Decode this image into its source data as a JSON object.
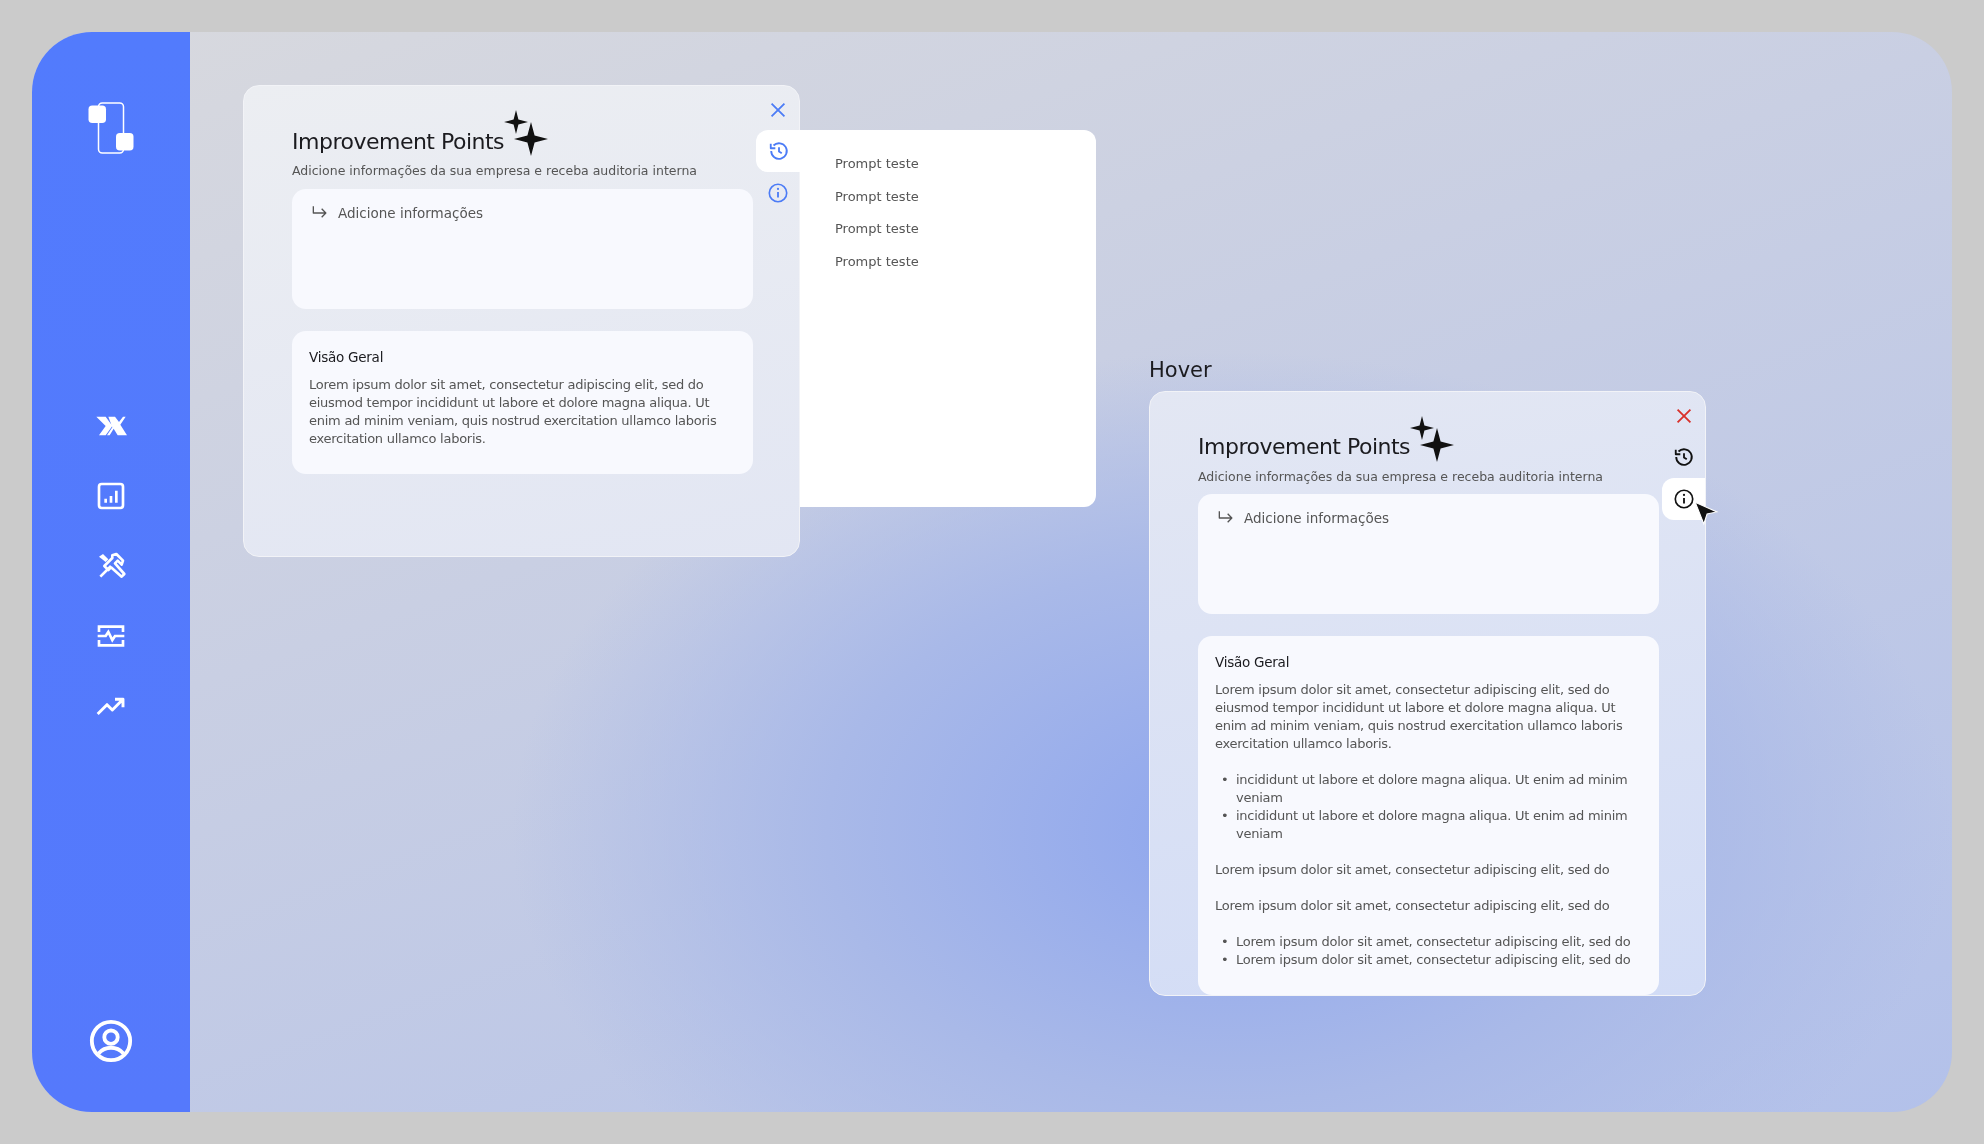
{
  "sidebar": {
    "items": [
      {
        "kind": "x-mark"
      },
      {
        "kind": "chart"
      },
      {
        "kind": "tools"
      },
      {
        "kind": "monitor"
      },
      {
        "kind": "trend"
      }
    ],
    "footer": [
      {
        "kind": "profile"
      }
    ]
  },
  "panels": [
    {
      "kind": "default",
      "title": "Improvement Points",
      "subtitle": "Adicione informações da sua empresa e receba auditoria interna",
      "input": {
        "placeholder": "Adicione informações"
      },
      "tools": [
        {
          "kind": "history",
          "selected": true,
          "hovered": false
        },
        {
          "kind": "info",
          "selected": false,
          "hovered": false
        }
      ],
      "overview": {
        "heading": "Visão Geral",
        "blocks": [
          {
            "kind": "paragraph",
            "text": "Lorem ipsum dolor sit amet, consectetur adipiscing elit, sed do eiusmod tempor incididunt ut labore et dolore magna aliqua. Ut enim ad minim veniam, quis nostrud exercitation ullamco laboris exercitation ullamco laboris."
          }
        ]
      },
      "history": [
        "Prompt teste",
        "Prompt teste",
        "Prompt teste",
        "Prompt teste"
      ]
    },
    {
      "kind": "hover",
      "label": "Hover",
      "title": "Improvement Points",
      "subtitle": "Adicione informações da sua empresa e receba auditoria interna",
      "input": {
        "placeholder": "Adicione informações"
      },
      "tools": [
        {
          "kind": "history",
          "selected": false,
          "hovered": false
        },
        {
          "kind": "info",
          "selected": false,
          "hovered": true
        }
      ],
      "overview": {
        "heading": "Visão Geral",
        "blocks": [
          {
            "kind": "paragraph",
            "text": "Lorem ipsum dolor sit amet, consectetur adipiscing elit, sed do eiusmod tempor incididunt ut labore et dolore magna aliqua. Ut enim ad minim veniam, quis nostrud exercitation ullamco laboris exercitation ullamco laboris."
          },
          {
            "kind": "list",
            "marker": "•",
            "items": [
              "incididunt ut labore et dolore magna aliqua. Ut enim ad minim veniam",
              "incididunt ut labore et dolore magna aliqua. Ut enim ad minim veniam"
            ]
          },
          {
            "kind": "paragraph",
            "text": "Lorem ipsum dolor sit amet, consectetur adipiscing elit, sed do"
          },
          {
            "kind": "paragraph",
            "text": "Lorem ipsum dolor sit amet, consectetur adipiscing elit, sed do"
          },
          {
            "kind": "list",
            "marker": "•",
            "items": [
              "Lorem ipsum dolor sit amet, consectetur adipiscing elit, sed do",
              "Lorem ipsum dolor sit amet, consectetur adipiscing elit, sed do"
            ]
          }
        ]
      }
    }
  ]
}
